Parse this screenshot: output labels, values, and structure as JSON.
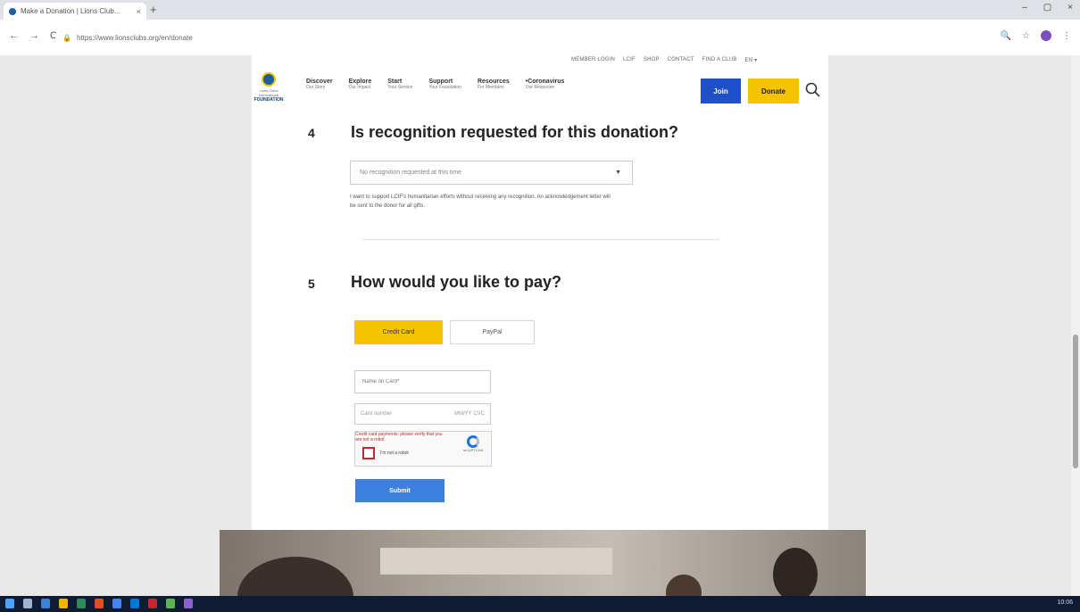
{
  "browser": {
    "tab_title": "Make a Donation | Lions Club...",
    "tab_close": "×",
    "new_tab": "+",
    "url": "https://www.lionsclubs.org/en/donate",
    "nav": {
      "back": "←",
      "forward": "→",
      "reload": "C"
    },
    "window_controls": {
      "minimize": "–",
      "maximize": "▢",
      "close": "×"
    }
  },
  "site": {
    "utility_links": [
      "MEMBER LOGIN",
      "LCIF",
      "SHOP",
      "CONTACT",
      "FIND A CLUB",
      "EN ▾"
    ],
    "logo": {
      "line": "Lions Clubs International",
      "name": "FOUNDATION"
    },
    "nav": [
      {
        "title": "Discover",
        "sub": "Our Story"
      },
      {
        "title": "Explore",
        "sub": "Our Impact"
      },
      {
        "title": "Start",
        "sub": "Your Service"
      },
      {
        "title": "Support",
        "sub": "Your Foundation"
      },
      {
        "title": "Resources",
        "sub": "For Members"
      },
      {
        "title": "•Coronavirus",
        "sub": "Our Response"
      }
    ],
    "join_label": "Join",
    "donate_label": "Donate"
  },
  "section4": {
    "number": "4",
    "question": "Is recognition requested for this donation?",
    "select_value": "No recognition requested at this time",
    "help_text": "I want to support LCIF's humanitarian efforts without receiving any recognition. An acknowledgement letter will be sent to the donor for all gifts."
  },
  "section5": {
    "number": "5",
    "question": "How would you like to pay?",
    "tab_credit": "Credit Card",
    "tab_paypal": "PayPal",
    "name_placeholder": "Name on Card*",
    "card_placeholder": "Card number",
    "card_expiry": "MM/YY CVC",
    "error_text": "Credit card payments: please verify that you are not a robot",
    "captcha_label": "I'm not a robot",
    "captcha_brand": "reCAPTCHA",
    "submit_label": "Submit"
  },
  "taskbar": {
    "tray": "10:06"
  }
}
